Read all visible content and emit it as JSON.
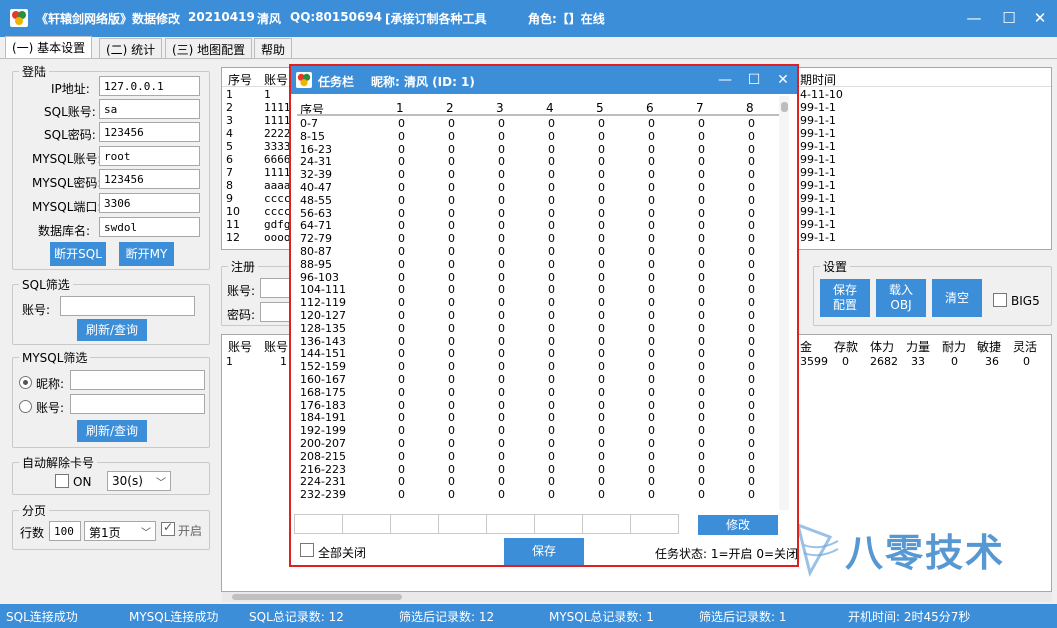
{
  "titlebar": {
    "app_name": "《轩辕剑网络版》数据修改",
    "version": "20210419",
    "author": "清风",
    "qq": "QQ:80150694",
    "service": "[承接订制各种工具",
    "role": "角色:【】在线"
  },
  "window_buttons": {
    "minimize": "—",
    "maximize": "☐",
    "close": "✕"
  },
  "tabs": [
    "(一) 基本设置",
    "(二) 统计",
    "(三) 地图配置",
    "帮助"
  ],
  "login": {
    "title": "登陆",
    "fields": [
      {
        "label": "IP地址:",
        "value": "127.0.0.1"
      },
      {
        "label": "SQL账号:",
        "value": "sa"
      },
      {
        "label": "SQL密码:",
        "value": "123456"
      },
      {
        "label": "MYSQL账号:",
        "value": "root"
      },
      {
        "label": "MYSQL密码:",
        "value": "123456"
      },
      {
        "label": "MYSQL端口:",
        "value": "3306"
      },
      {
        "label": "数据库名:",
        "value": "swdol"
      }
    ],
    "btn_disconnect_sql": "断开SQL",
    "btn_disconnect_my": "断开MY"
  },
  "sql_filter": {
    "title": "SQL筛选",
    "account_label": "账号:",
    "account_value": "",
    "refresh": "刷新/查询"
  },
  "mysql_filter": {
    "title": "MYSQL筛选",
    "nickname_label": "昵称:",
    "account_label": "账号:",
    "refresh": "刷新/查询"
  },
  "auto_unlock": {
    "title": "自动解除卡号",
    "on_label": "ON",
    "interval": "30(s)"
  },
  "paging": {
    "title": "分页",
    "rows_label": "行数",
    "rows_value": "100",
    "page": "第1页",
    "enable_label": "开启"
  },
  "register": {
    "title": "注册",
    "account_label": "账号:",
    "password_label": "密码:"
  },
  "settings": {
    "title": "设置",
    "save_config": "保存配置",
    "load_obj": "载入OBJ",
    "clear": "清空",
    "big5": "BIG5"
  },
  "top_grid": {
    "headers": [
      "序号",
      "账号"
    ],
    "rows": [
      [
        "1",
        "1"
      ],
      [
        "2",
        "1111"
      ],
      [
        "3",
        "1111"
      ],
      [
        "4",
        "2222"
      ],
      [
        "5",
        "3333"
      ],
      [
        "6",
        "6666"
      ],
      [
        "7",
        "1111"
      ],
      [
        "8",
        "aaaa"
      ],
      [
        "9",
        "cccc"
      ],
      [
        "10",
        "cccc"
      ],
      [
        "11",
        "gdfg"
      ],
      [
        "12",
        "oooo"
      ]
    ],
    "date_header": "期时间",
    "dates": [
      "4-11-10",
      "99-1-1",
      "99-1-1",
      "99-1-1",
      "99-1-1",
      "99-1-1",
      "99-1-1",
      "99-1-1",
      "99-1-1",
      "99-1-1",
      "99-1-1",
      "99-1-1"
    ]
  },
  "bottom_grid": {
    "headers_left": [
      "账号",
      "账号"
    ],
    "row_left": [
      "1",
      "1"
    ],
    "headers_right": [
      "金",
      "存款",
      "体力",
      "力量",
      "耐力",
      "敏捷",
      "灵活"
    ],
    "row_right": [
      "3599",
      "0",
      "2682",
      "33",
      "0",
      "36",
      "0"
    ]
  },
  "status": {
    "sql_conn": "SQL连接成功",
    "mysql_conn": "MYSQL连接成功",
    "sql_total": "SQL总记录数:  12",
    "filtered1": "筛选后记录数:  12",
    "mysql_total": "MYSQL总记录数:  1",
    "filtered2": "筛选后记录数:  1",
    "uptime": "开机时间:  2时45分7秒"
  },
  "dialog": {
    "title": "任务栏",
    "nickname": "昵称: 清风 (ID: 1)",
    "columns": [
      "序号",
      "1",
      "2",
      "3",
      "4",
      "5",
      "6",
      "7",
      "8"
    ],
    "rows": [
      [
        "0-7",
        "0",
        "0",
        "0",
        "0",
        "0",
        "0",
        "0",
        "0"
      ],
      [
        "8-15",
        "0",
        "0",
        "0",
        "0",
        "0",
        "0",
        "0",
        "0"
      ],
      [
        "16-23",
        "0",
        "0",
        "0",
        "0",
        "0",
        "0",
        "0",
        "0"
      ],
      [
        "24-31",
        "0",
        "0",
        "0",
        "0",
        "0",
        "0",
        "0",
        "0"
      ],
      [
        "32-39",
        "0",
        "0",
        "0",
        "0",
        "0",
        "0",
        "0",
        "0"
      ],
      [
        "40-47",
        "0",
        "0",
        "0",
        "0",
        "0",
        "0",
        "0",
        "0"
      ],
      [
        "48-55",
        "0",
        "0",
        "0",
        "0",
        "0",
        "0",
        "0",
        "0"
      ],
      [
        "56-63",
        "0",
        "0",
        "0",
        "0",
        "0",
        "0",
        "0",
        "0"
      ],
      [
        "64-71",
        "0",
        "0",
        "0",
        "0",
        "0",
        "0",
        "0",
        "0"
      ],
      [
        "72-79",
        "0",
        "0",
        "0",
        "0",
        "0",
        "0",
        "0",
        "0"
      ],
      [
        "80-87",
        "0",
        "0",
        "0",
        "0",
        "0",
        "0",
        "0",
        "0"
      ],
      [
        "88-95",
        "0",
        "0",
        "0",
        "0",
        "0",
        "0",
        "0",
        "0"
      ],
      [
        "96-103",
        "0",
        "0",
        "0",
        "0",
        "0",
        "0",
        "0",
        "0"
      ],
      [
        "104-111",
        "0",
        "0",
        "0",
        "0",
        "0",
        "0",
        "0",
        "0"
      ],
      [
        "112-119",
        "0",
        "0",
        "0",
        "0",
        "0",
        "0",
        "0",
        "0"
      ],
      [
        "120-127",
        "0",
        "0",
        "0",
        "0",
        "0",
        "0",
        "0",
        "0"
      ],
      [
        "128-135",
        "0",
        "0",
        "0",
        "0",
        "0",
        "0",
        "0",
        "0"
      ],
      [
        "136-143",
        "0",
        "0",
        "0",
        "0",
        "0",
        "0",
        "0",
        "0"
      ],
      [
        "144-151",
        "0",
        "0",
        "0",
        "0",
        "0",
        "0",
        "0",
        "0"
      ],
      [
        "152-159",
        "0",
        "0",
        "0",
        "0",
        "0",
        "0",
        "0",
        "0"
      ],
      [
        "160-167",
        "0",
        "0",
        "0",
        "0",
        "0",
        "0",
        "0",
        "0"
      ],
      [
        "168-175",
        "0",
        "0",
        "0",
        "0",
        "0",
        "0",
        "0",
        "0"
      ],
      [
        "176-183",
        "0",
        "0",
        "0",
        "0",
        "0",
        "0",
        "0",
        "0"
      ],
      [
        "184-191",
        "0",
        "0",
        "0",
        "0",
        "0",
        "0",
        "0",
        "0"
      ],
      [
        "192-199",
        "0",
        "0",
        "0",
        "0",
        "0",
        "0",
        "0",
        "0"
      ],
      [
        "200-207",
        "0",
        "0",
        "0",
        "0",
        "0",
        "0",
        "0",
        "0"
      ],
      [
        "208-215",
        "0",
        "0",
        "0",
        "0",
        "0",
        "0",
        "0",
        "0"
      ],
      [
        "216-223",
        "0",
        "0",
        "0",
        "0",
        "0",
        "0",
        "0",
        "0"
      ],
      [
        "224-231",
        "0",
        "0",
        "0",
        "0",
        "0",
        "0",
        "0",
        "0"
      ],
      [
        "232-239",
        "0",
        "0",
        "0",
        "0",
        "0",
        "0",
        "0",
        "0"
      ]
    ],
    "modify": "修改",
    "close_all": "全部关闭",
    "save": "保存",
    "status_legend": "任务状态: 1=开启 0=关闭"
  },
  "watermark": {
    "text": "八零技术"
  },
  "colors": {
    "accent": "#3c8ed9",
    "dialog_border": "#e02020",
    "watermark": "#2f7fc8"
  }
}
